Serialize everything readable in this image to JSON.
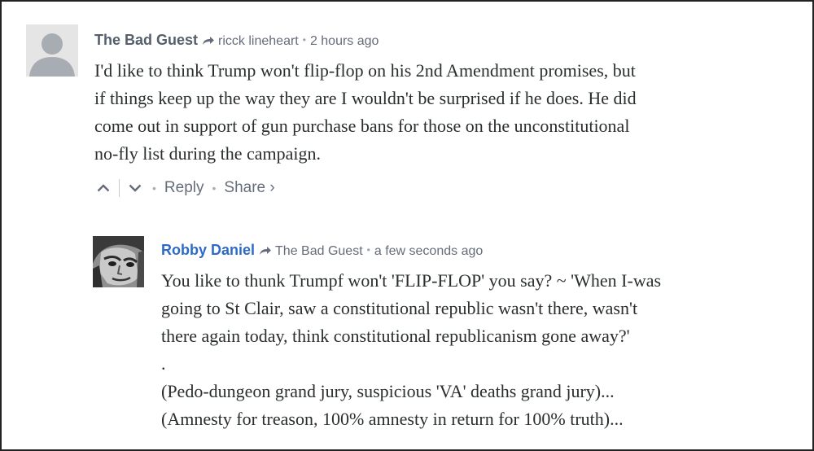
{
  "comments": [
    {
      "author": "The Bad Guest",
      "reply_to": "ricck lineheart",
      "time": "2 hours ago",
      "body_lines": [
        "I'd like to think Trump won't flip-flop on his 2nd Amendment promises, but",
        "if things keep up the way they are I wouldn't be surprised if he does. He did",
        "come out in support of gun purchase bans for those on the unconstitutional",
        "no-fly list during the campaign."
      ],
      "actions": {
        "reply": "Reply",
        "share": "Share ›"
      },
      "avatar": "default-avatar-icon"
    },
    {
      "author": "Robby Daniel",
      "reply_to": "The Bad Guest",
      "time": "a few seconds ago",
      "body_lines": [
        "You like to thunk Trumpf won't 'FLIP-FLOP' you say? ~ 'When I-was",
        "going to St Clair, saw a constitutional republic wasn't there, wasn't",
        "there again today, think constitutional republicanism gone away?'",
        ".",
        "(Pedo-dungeon grand jury, suspicious 'VA' deaths grand jury)...",
        "(Amnesty for treason, 100% amnesty in return for 100% truth)..."
      ],
      "avatar": "user-photo-avatar"
    }
  ],
  "colors": {
    "author_gray": "#555f6b",
    "author_blue": "#2e6bc6",
    "meta_gray": "#656c7a",
    "body_text": "#2a2e2e"
  }
}
